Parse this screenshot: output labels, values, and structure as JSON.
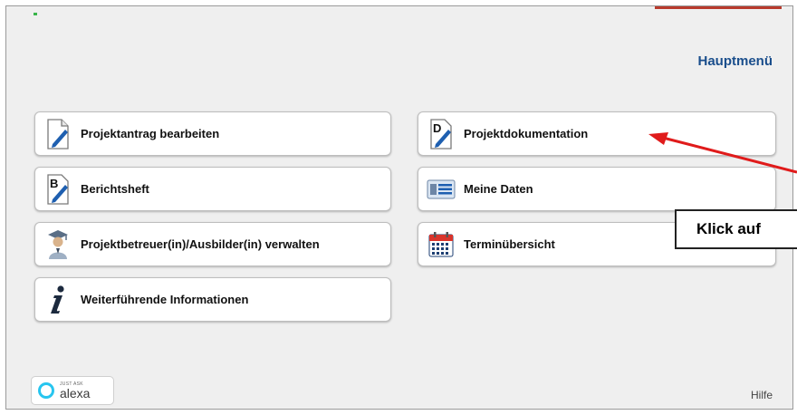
{
  "header": {
    "title": "Hauptmenü"
  },
  "menu": {
    "projektantrag": "Projektantrag bearbeiten",
    "berichtsheft": "Berichtsheft",
    "betreuer": "Projektbetreuer(in)/Ausbilder(in) verwalten",
    "informationen": "Weiterführende Informationen",
    "dokumentation": "Projektdokumentation",
    "meine_daten": "Meine Daten",
    "termine": "Terminübersicht"
  },
  "icons": {
    "projektantrag": "document-pen-icon",
    "berichtsheft": "document-b-pen-icon",
    "betreuer": "graduate-person-icon",
    "informationen": "info-i-icon",
    "dokumentation": "document-d-pen-icon",
    "meine_daten": "id-card-icon",
    "termine": "calendar-icon"
  },
  "annotation": {
    "callout_text": "Klick auf"
  },
  "alexa_badge": {
    "small_text": "JUST ASK",
    "brand": "alexa"
  },
  "footer": {
    "help": "Hilfe"
  },
  "colors": {
    "title": "#1a4e8c",
    "arrow": "#e01b1b",
    "pen": "#1e5fb0",
    "calendar_red": "#d9342b",
    "alexa_ring": "#27c5ef"
  }
}
